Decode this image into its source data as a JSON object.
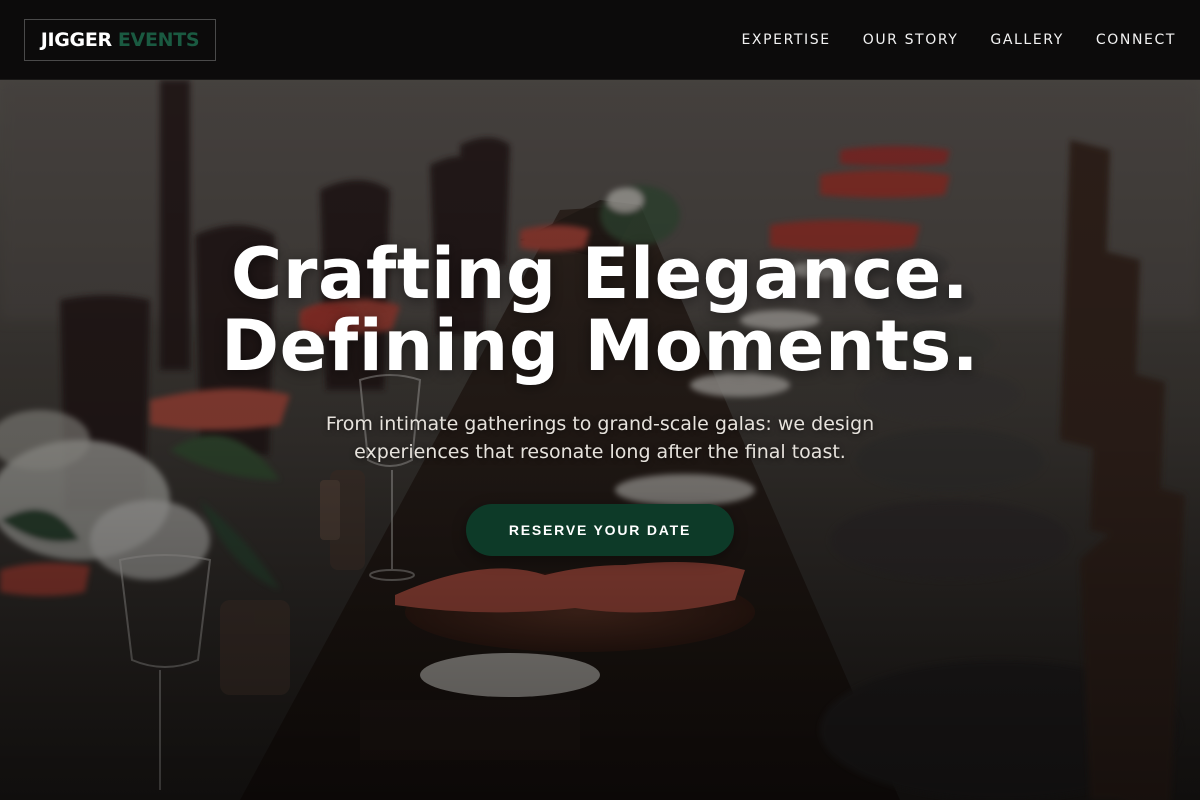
{
  "header": {
    "logo": {
      "word_1": "JIGGER",
      "word_2": "EVENTS"
    },
    "nav": [
      {
        "label": "EXPERTISE"
      },
      {
        "label": "OUR STORY"
      },
      {
        "label": "GALLERY"
      },
      {
        "label": "CONNECT"
      }
    ]
  },
  "hero": {
    "title_line_1": "Crafting Elegance.",
    "title_line_2": "Defining Moments.",
    "subtitle": "From intimate gatherings to grand-scale galas: we design experiences that resonate long after the final toast.",
    "cta_label": "RESERVE YOUR DATE",
    "background": "photo-event-dinner-table"
  },
  "colors": {
    "header_bg": "#0c0b0b",
    "logo_accent": "#1a5a41",
    "cta_bg": "#0d3a28",
    "text": "#ffffff"
  }
}
